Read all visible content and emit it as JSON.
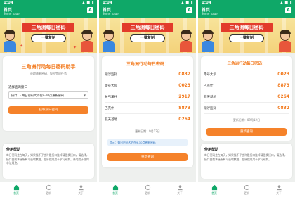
{
  "status": {
    "time": "1:04",
    "signal": "▲ ■ ▮"
  },
  "app": {
    "title": "首页",
    "subtitle": "Some page",
    "icon_letter": "A"
  },
  "banner": {
    "title": "三角洲每日密码",
    "pill": "一键复制"
  },
  "screen1": {
    "heading": "三角洲行动每日密码助手",
    "subheading": "获取最新密码，轻松完成任务",
    "select_label": "选择查询接口",
    "select_value": "接口1 - 每日密码大约在9-10点更新密码",
    "button": "获取今日密码",
    "help_title": "使用帮助",
    "help_text": "每日密码会在每天，如果找不了也许是接口挂掉请更换接口，请选择，接口目前承接所有可获取数据，程序仅限用于学习研究，请勿用于任何非法用途。"
  },
  "screen2": {
    "heading": "三角洲行动每日密码：",
    "rows": [
      {
        "name": "潮汐监狱",
        "code": "0832"
      },
      {
        "name": "零号大坝",
        "code": "0023"
      },
      {
        "name": "长弓溪谷",
        "code": "2917"
      },
      {
        "name": "巴克什",
        "code": "8873"
      },
      {
        "name": "航天基地",
        "code": "0264"
      }
    ],
    "updated": "更新日期：9月12日",
    "notice": "提示：每日密码大约在9-10点更新密码",
    "button": "重新查询"
  },
  "screen3": {
    "heading": "三角洲行动每日密码：",
    "rows": [
      {
        "name": "零号大坝",
        "code": "0023"
      },
      {
        "name": "巴克什",
        "code": "8873"
      },
      {
        "name": "航天基地",
        "code": "0264"
      },
      {
        "name": "潮汐监狱",
        "code": "0832"
      }
    ],
    "updated": "更新日期：09月12日",
    "button": "重新查询",
    "help_title": "使用帮助",
    "help_text": "每日密码会在每天，如果找不了也许是接口挂掉请更换接口，请选择，接口目前承接所有可获取数据，程序仅限用于学习研究。"
  },
  "nav": {
    "home": "首页",
    "update": "更新",
    "about": "关于"
  },
  "colors": {
    "brand_green": "#0fa868",
    "accent_orange": "#f27a1e",
    "button_orange": "#f5822a"
  }
}
